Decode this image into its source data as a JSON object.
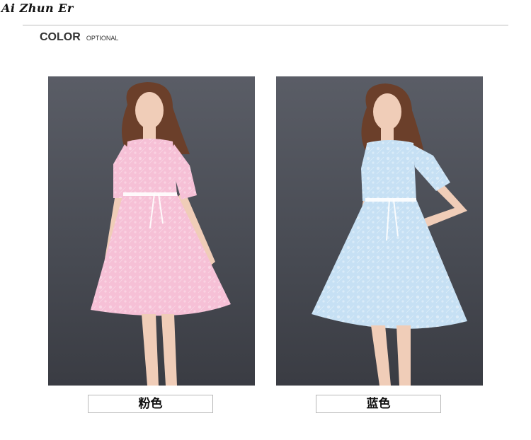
{
  "brand": "Ai Zhun Er",
  "section": {
    "title": "COLOR",
    "subtitle": "OPTIONAL"
  },
  "options": [
    {
      "label": "粉色",
      "dress_color": "#f6c0d6",
      "accent_color": "#fbe3ec"
    },
    {
      "label": "蓝色",
      "dress_color": "#c6e0f4",
      "accent_color": "#e7f2fb"
    }
  ],
  "colors": {
    "backdrop": "#4a4d55",
    "skin": "#f0cdb8",
    "hair": "#6b3f2a"
  }
}
